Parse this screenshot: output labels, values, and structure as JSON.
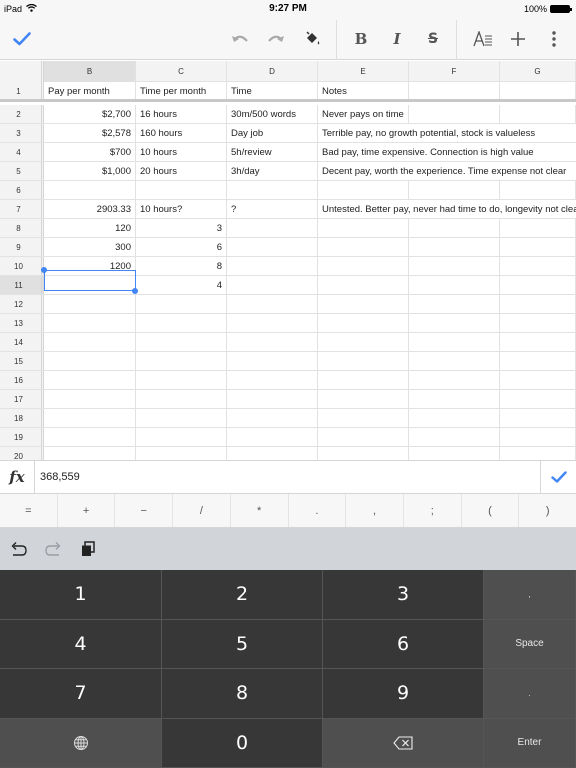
{
  "status_bar": {
    "device": "iPad",
    "time": "9:27 PM",
    "battery": "100%"
  },
  "toolbar": {
    "buttons": [
      {
        "name": "done",
        "icon": "checkmark-icon"
      },
      {
        "name": "undo",
        "icon": "undo-icon"
      },
      {
        "name": "redo",
        "icon": "redo-icon"
      },
      {
        "name": "fill-color",
        "icon": "paint-bucket-icon"
      },
      {
        "name": "bold",
        "icon": "bold-icon"
      },
      {
        "name": "italic",
        "icon": "italic-icon"
      },
      {
        "name": "strikethrough",
        "icon": "strikethrough-icon"
      },
      {
        "name": "text-format",
        "icon": "text-format-icon"
      },
      {
        "name": "insert",
        "icon": "plus-icon"
      },
      {
        "name": "more",
        "icon": "more-vertical-icon"
      }
    ]
  },
  "sheet": {
    "columns": [
      "B",
      "C",
      "D",
      "E",
      "F",
      "G"
    ],
    "selected_column": "B",
    "selected_row": "11",
    "rows": [
      {
        "num": "1",
        "cells": {
          "B": "Pay per month",
          "C": "Time per month",
          "D": "Time",
          "E": "Notes",
          "F": "",
          "G": ""
        }
      },
      {
        "num": "2",
        "cells": {
          "B": "$2,700",
          "C": "16 hours",
          "D": "30m/500 words",
          "E": "Never pays on time",
          "F": "",
          "G": ""
        }
      },
      {
        "num": "3",
        "cells": {
          "B": "$2,578",
          "C": "160 hours",
          "D": "Day job",
          "E": "Terrible pay, no growth potential, stock is valueless",
          "F": "",
          "G": ""
        }
      },
      {
        "num": "4",
        "cells": {
          "B": "$700",
          "C": "10 hours",
          "D": "5h/review",
          "E": "Bad pay, time expensive. Connection is high value",
          "F": "",
          "G": ""
        }
      },
      {
        "num": "5",
        "cells": {
          "B": "$1,000",
          "C": "20 hours",
          "D": "3h/day",
          "E": "Decent pay, worth the experience. Time expense not clear",
          "F": "",
          "G": ""
        }
      },
      {
        "num": "6",
        "cells": {
          "B": "",
          "C": "",
          "D": "",
          "E": "",
          "F": "",
          "G": ""
        }
      },
      {
        "num": "7",
        "cells": {
          "B": "2903.33",
          "C": "10 hours?",
          "D": "?",
          "E": "Untested. Better pay, never had time to do, longevity not clear",
          "F": "",
          "G": ""
        }
      },
      {
        "num": "8",
        "cells": {
          "B": "120",
          "C": "3",
          "D": "",
          "E": "",
          "F": "",
          "G": ""
        }
      },
      {
        "num": "9",
        "cells": {
          "B": "300",
          "C": "6",
          "D": "",
          "E": "",
          "F": "",
          "G": ""
        }
      },
      {
        "num": "10",
        "cells": {
          "B": "1200",
          "C": "8",
          "D": "",
          "E": "",
          "F": "",
          "G": ""
        }
      },
      {
        "num": "11",
        "cells": {
          "B": "",
          "C": "4",
          "D": "",
          "E": "",
          "F": "",
          "G": ""
        }
      },
      {
        "num": "12",
        "cells": {
          "B": "",
          "C": "",
          "D": "",
          "E": "",
          "F": "",
          "G": ""
        }
      },
      {
        "num": "13",
        "cells": {
          "B": "",
          "C": "",
          "D": "",
          "E": "",
          "F": "",
          "G": ""
        }
      },
      {
        "num": "14",
        "cells": {
          "B": "",
          "C": "",
          "D": "",
          "E": "",
          "F": "",
          "G": ""
        }
      },
      {
        "num": "15",
        "cells": {
          "B": "",
          "C": "",
          "D": "",
          "E": "",
          "F": "",
          "G": ""
        }
      },
      {
        "num": "16",
        "cells": {
          "B": "",
          "C": "",
          "D": "",
          "E": "",
          "F": "",
          "G": ""
        }
      },
      {
        "num": "17",
        "cells": {
          "B": "",
          "C": "",
          "D": "",
          "E": "",
          "F": "",
          "G": ""
        }
      },
      {
        "num": "18",
        "cells": {
          "B": "",
          "C": "",
          "D": "",
          "E": "",
          "F": "",
          "G": ""
        }
      },
      {
        "num": "19",
        "cells": {
          "B": "",
          "C": "",
          "D": "",
          "E": "",
          "F": "",
          "G": ""
        }
      },
      {
        "num": "20",
        "cells": {
          "B": "",
          "C": "",
          "D": "",
          "E": "",
          "F": "",
          "G": ""
        }
      }
    ]
  },
  "formula_bar": {
    "label": "fx",
    "value": "368,559"
  },
  "operators": [
    "=",
    "+",
    "−",
    "/",
    "*",
    ".",
    ",",
    ";",
    "(",
    ")"
  ],
  "keypad": {
    "keys": [
      "1",
      "2",
      "3",
      ",",
      "4",
      "5",
      "6",
      "Space",
      "7",
      "8",
      "9",
      ".",
      "globe",
      "0",
      "backspace",
      "Enter"
    ]
  },
  "colors": {
    "accent": "#4285f4",
    "keypad_key": "#373737",
    "keypad_func": "#4f4f4f"
  }
}
